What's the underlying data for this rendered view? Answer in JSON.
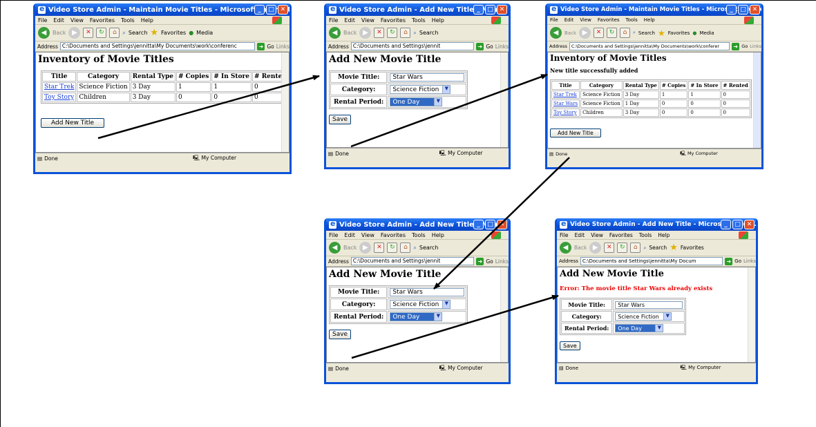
{
  "menu": [
    "File",
    "Edit",
    "View",
    "Favorites",
    "Tools",
    "Help"
  ],
  "toolbar": {
    "back": "Back",
    "search": "Search",
    "favorites": "Favorites",
    "media": "Media"
  },
  "address_label": "Address",
  "go_label": "Go",
  "links_label": "Links",
  "status_done": "Done",
  "status_zone": "My Computer",
  "inventory": {
    "title": "Video Store Admin - Maintain Movie Titles - Microsoft Internet Expl...",
    "address": "C:\\Documents and Settings\\jennitta\\My Documents\\work\\conferenc",
    "heading": "Inventory of Movie Titles",
    "columns": [
      "Title",
      "Category",
      "Rental Type",
      "# Copies",
      "# In Store",
      "# Rented"
    ],
    "rows": [
      [
        "Star Trek",
        "Science Fiction",
        "3 Day",
        "1",
        "1",
        "0"
      ],
      [
        "Toy Story",
        "Children",
        "3 Day",
        "0",
        "0",
        "0"
      ]
    ],
    "add_button": "Add New Title"
  },
  "add_form_1": {
    "title": "Video Store Admin - Add New Title - Micr...",
    "address": "C:\\Documents and Settings\\jennit",
    "heading": "Add New Movie Title",
    "movie_title_label": "Movie Title:",
    "movie_title_value": "Star Wars",
    "category_label": "Category:",
    "category_value": "Science Fiction",
    "rental_label": "Rental Period:",
    "rental_value": "One Day",
    "save_button": "Save"
  },
  "inventory_2": {
    "title": "Video Store Admin - Maintain Movie Titles - Microsoft Internet Exp...",
    "address": "C:\\Documents and Settings\\jennitta\\My Documents\\work\\conferer",
    "heading": "Inventory of Movie Titles",
    "message": "New title successfully added",
    "columns": [
      "Title",
      "Category",
      "Rental Type",
      "# Copies",
      "# In Store",
      "# Rented"
    ],
    "rows": [
      [
        "Star Trek",
        "Science Fiction",
        "3 Day",
        "1",
        "1",
        "0"
      ],
      [
        "Star Wars",
        "Science Fiction",
        "1 Day",
        "0",
        "0",
        "0"
      ],
      [
        "Toy Story",
        "Children",
        "3 Day",
        "0",
        "0",
        "0"
      ]
    ],
    "add_button": "Add New Title"
  },
  "add_form_2": {
    "title": "Video Store Admin - Add New Title - Micr...",
    "address": "C:\\Documents and Settings\\jennit",
    "heading": "Add New Movie Title",
    "movie_title_label": "Movie Title:",
    "movie_title_value": "Star Wars",
    "category_label": "Category:",
    "category_value": "Science Fiction",
    "rental_label": "Rental Period:",
    "rental_value": "One Day",
    "save_button": "Save"
  },
  "add_form_error": {
    "title": "Video Store Admin - Add New Title - Microsoft Inter...",
    "address": "C:\\Documents and Settings\\jennitta\\My Docum",
    "heading": "Add New Movie Title",
    "error": "Error: The movie title Star Wars already exists",
    "movie_title_label": "Movie Title:",
    "movie_title_value": "Star Wars",
    "category_label": "Category:",
    "category_value": "Science Fiction",
    "rental_label": "Rental Period:",
    "rental_value": "One Day",
    "save_button": "Save"
  }
}
